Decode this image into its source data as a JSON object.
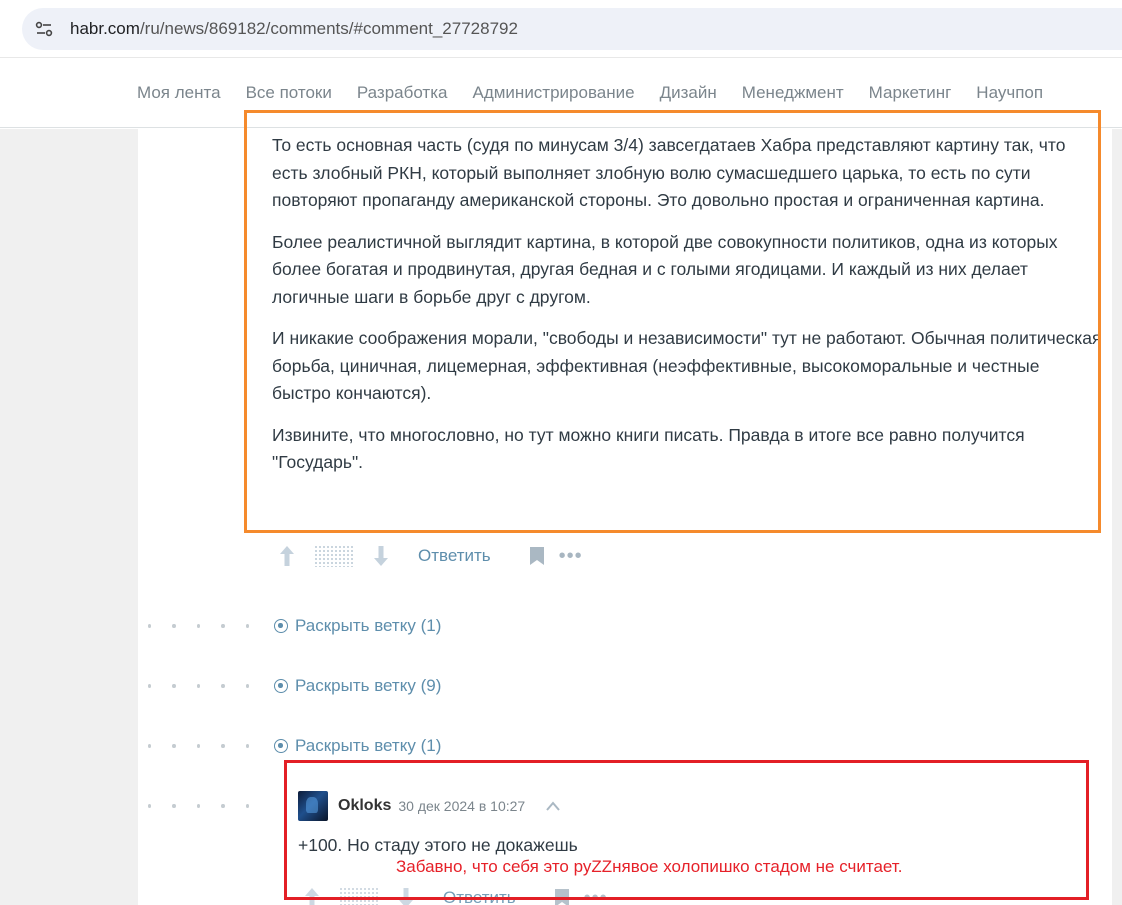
{
  "browser": {
    "url_host": "habr.com",
    "url_path": "/ru/news/869182/comments/#comment_27728792"
  },
  "nav": {
    "items": [
      "Моя лента",
      "Все потоки",
      "Разработка",
      "Администрирование",
      "Дизайн",
      "Менеджмент",
      "Маркетинг",
      "Научпоп"
    ]
  },
  "comment": {
    "paragraphs": [
      "То есть основная часть (судя по минусам 3/4) завсегдатаев Хабра представляют картину так, что есть злобный РКН, который выполняет злобную волю сумасшедшего царька, то есть по сути повторяют пропаганду американской стороны. Это довольно простая и ограниченная картина.",
      "Более реалистичной выглядит картина, в которой две совокупности политиков, одна из которых более богатая и продвинутая, другая бедная и с голыми ягодицами. И каждый из них делает логичные шаги в борьбе друг с другом.",
      "И никакие соображения морали, \"свободы и независимости\" тут не работают. Обычная политическая борьба, циничная, лицемерная, эффективная (неэффективные, высокоморальные и честные быстро кончаются).",
      "Извините, что многословно, но тут можно книги писать. Правда в итоге все равно получится \"Государь\"."
    ],
    "reply_label": "Ответить"
  },
  "threads": [
    {
      "label": "Раскрыть ветку (1)"
    },
    {
      "label": "Раскрыть ветку (9)"
    },
    {
      "label": "Раскрыть ветку (1)"
    }
  ],
  "reply_comment": {
    "username": "Okloks",
    "date": "30 дек 2024 в 10:27",
    "text": "+100. Но стаду этого не докажешь",
    "reply_label": "Ответить"
  },
  "annotation": {
    "text": "Забавно, что себя это руZZнявое холопишко стадом не считает."
  },
  "colors": {
    "orange_box": "#f58a2c",
    "red_box": "#e31f26",
    "link": "#5e8eac",
    "nav_text": "#7b858c"
  }
}
